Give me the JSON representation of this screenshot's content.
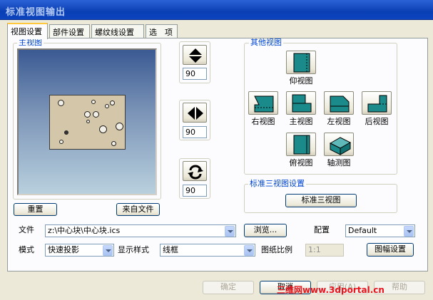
{
  "window": {
    "title": "标准视图输出"
  },
  "tabs": [
    "视图设置",
    "部件设置",
    "螺纹线设置",
    "选　项"
  ],
  "main_view": {
    "legend": "主视图",
    "reset_label": "重置",
    "from_file_label": "来自文件"
  },
  "rotation": {
    "vertical_value": "90",
    "horizontal_value": "90",
    "rotate_value": "90"
  },
  "other_views": {
    "legend": "其他视图",
    "bottom": "仰视图",
    "right": "右视图",
    "front": "主视图",
    "left": "左视图",
    "back": "后视图",
    "top": "俯视图",
    "iso": "轴测图"
  },
  "std_three": {
    "legend": "标准三视图设置",
    "button": "标准三视图"
  },
  "file": {
    "label": "文件",
    "value": "z:\\中心块\\中心块.ics",
    "browse": "浏览...",
    "config_label": "配置",
    "config_value": "Default"
  },
  "mode": {
    "label": "模式",
    "value": "快速投影",
    "display_label": "显示样式",
    "display_value": "线框",
    "scale_label": "图纸比例",
    "scale_value": "1:1",
    "frame_settings": "图幅设置"
  },
  "footer": {
    "ok": "确定",
    "cancel": "取消",
    "apply": "应用(A)",
    "help": "帮助"
  },
  "watermark": "三维网www.3dportal.cn",
  "colors": {
    "accent": "#0046d5",
    "titlebar": "#0a3fb4",
    "view_icon": "#1b8a8a"
  }
}
